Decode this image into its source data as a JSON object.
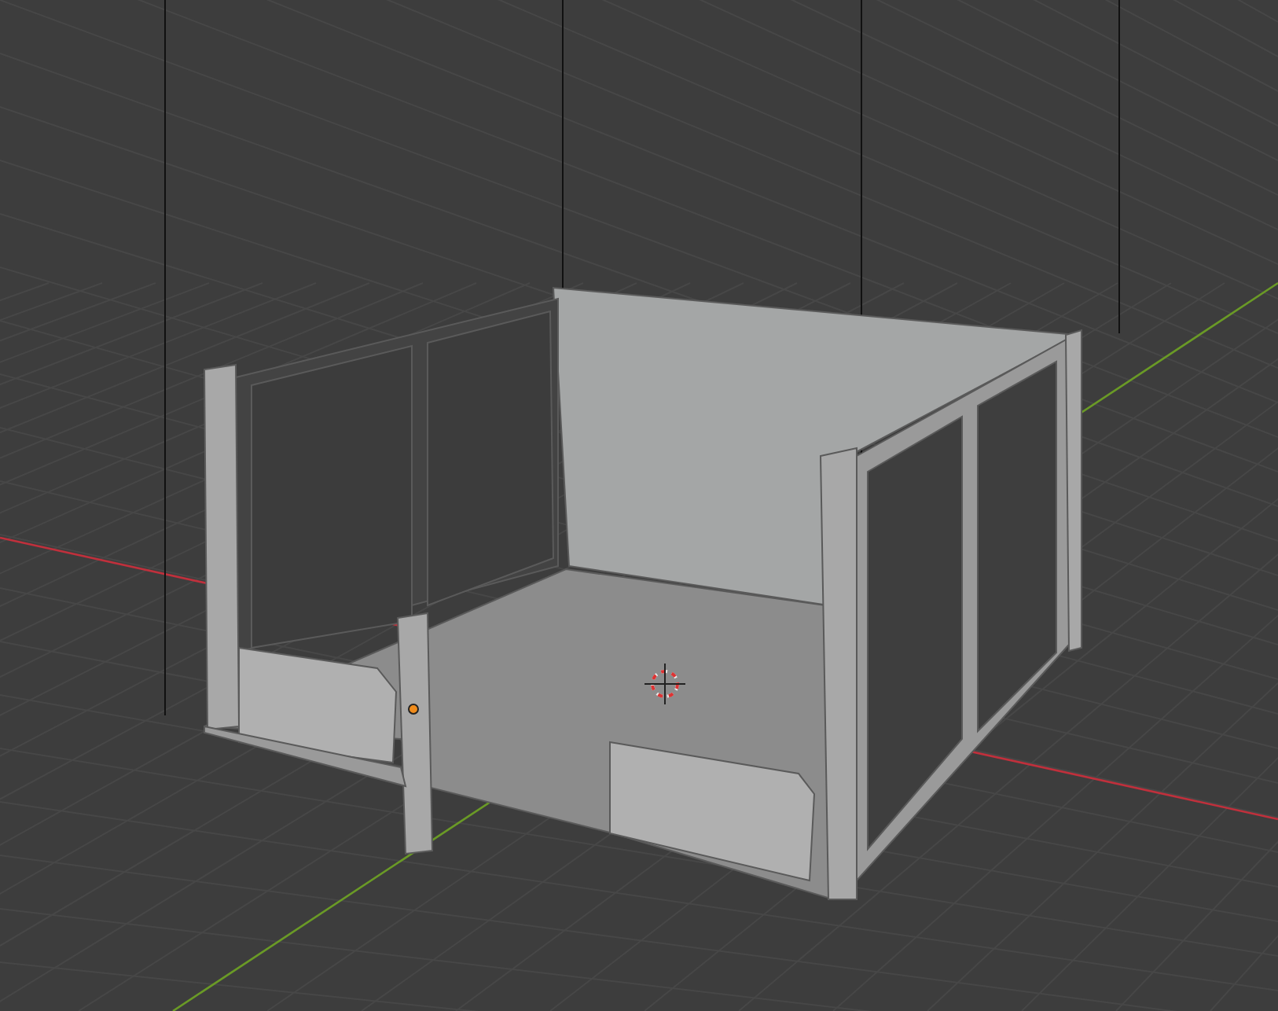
{
  "viewport": {
    "show_grid": true,
    "show_axes": true,
    "show_3d_cursor": true,
    "show_origin": true
  }
}
